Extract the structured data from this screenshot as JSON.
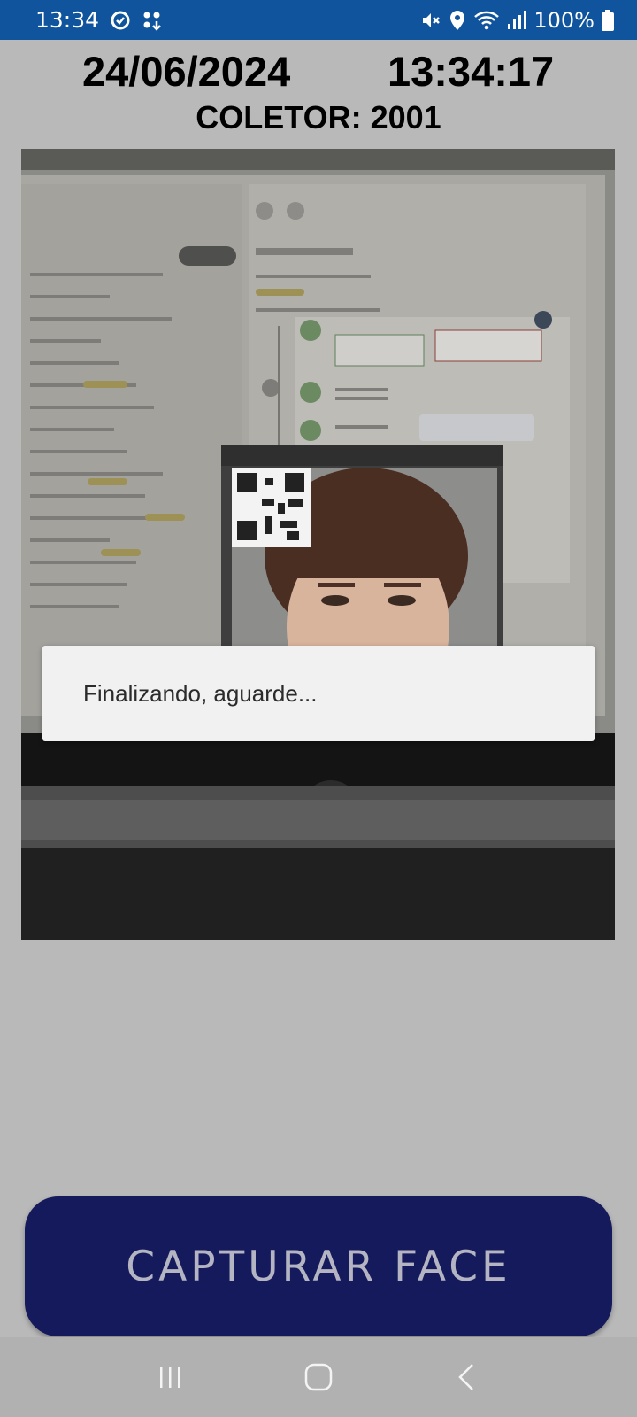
{
  "status_bar": {
    "time": "13:34",
    "battery": "100%",
    "icons": [
      "tracking-icon",
      "apps-icon",
      "mute-icon",
      "location-icon",
      "wifi-icon",
      "signal-icon",
      "battery-icon"
    ]
  },
  "header": {
    "date": "24/06/2024",
    "clock": "13:34:17",
    "collector": "COLETOR: 2001"
  },
  "dialog": {
    "message": "Finalizando, aguarde..."
  },
  "capture_button": {
    "label": "CAPTURAR FACE"
  },
  "nav_bar": {
    "icons": [
      "recent-apps-icon",
      "home-icon",
      "back-icon"
    ]
  },
  "colors": {
    "status_bar": "#0f549c",
    "background": "#b9b9b9",
    "button": "#141a5c",
    "button_text": "#b4b4c2"
  }
}
